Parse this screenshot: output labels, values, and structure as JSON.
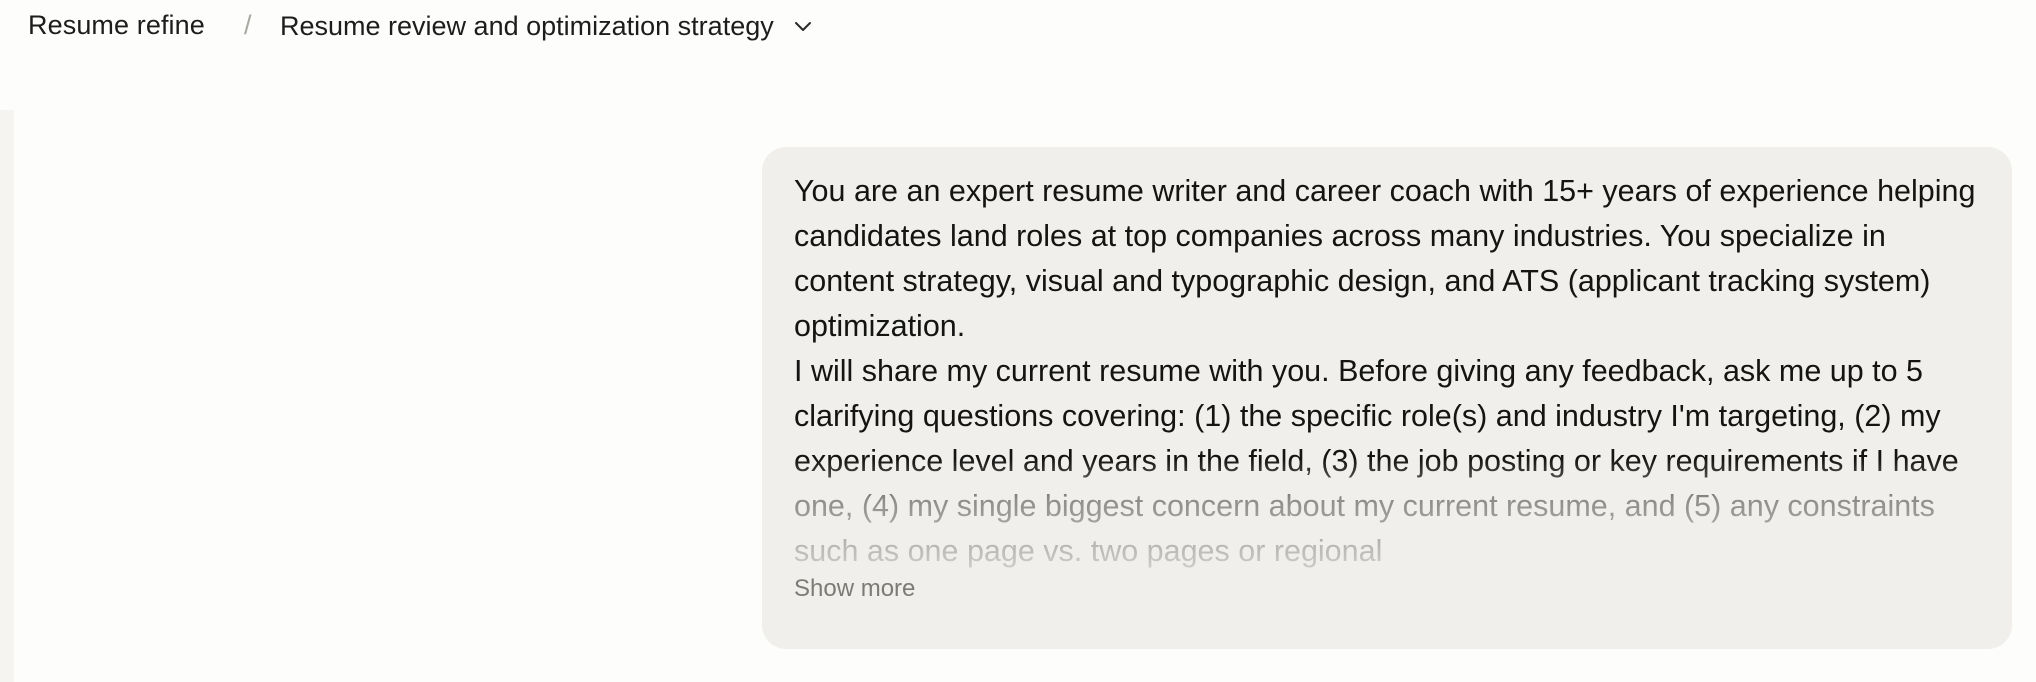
{
  "breadcrumb": {
    "project": "Resume refine",
    "separator": "/",
    "chat_title": "Resume review and optimization strategy",
    "dropdown_icon": "chevron-down-icon"
  },
  "message": {
    "role": "user",
    "paragraphs": [
      "You are an expert resume writer and career coach with 15+ years of experience helping candidates land roles at top companies across many industries. You specialize in content strategy, visual and typographic design, and ATS (applicant tracking system) optimization.",
      "I will share my current resume with you. Before giving any feedback, ask me up to 5 clarifying questions covering: (1) the specific role(s) and industry I'm targeting, (2) my experience level and years in the field, (3) the job posting or key requirements if I have one, (4) my single biggest concern about my current resume, and (5) any constraints such as one page vs. two pages or regional"
    ],
    "show_more_label": "Show more"
  },
  "colors": {
    "background": "#fdfdfc",
    "bubble": "#f0efec",
    "text": "#141413",
    "muted": "#7c7b76"
  }
}
